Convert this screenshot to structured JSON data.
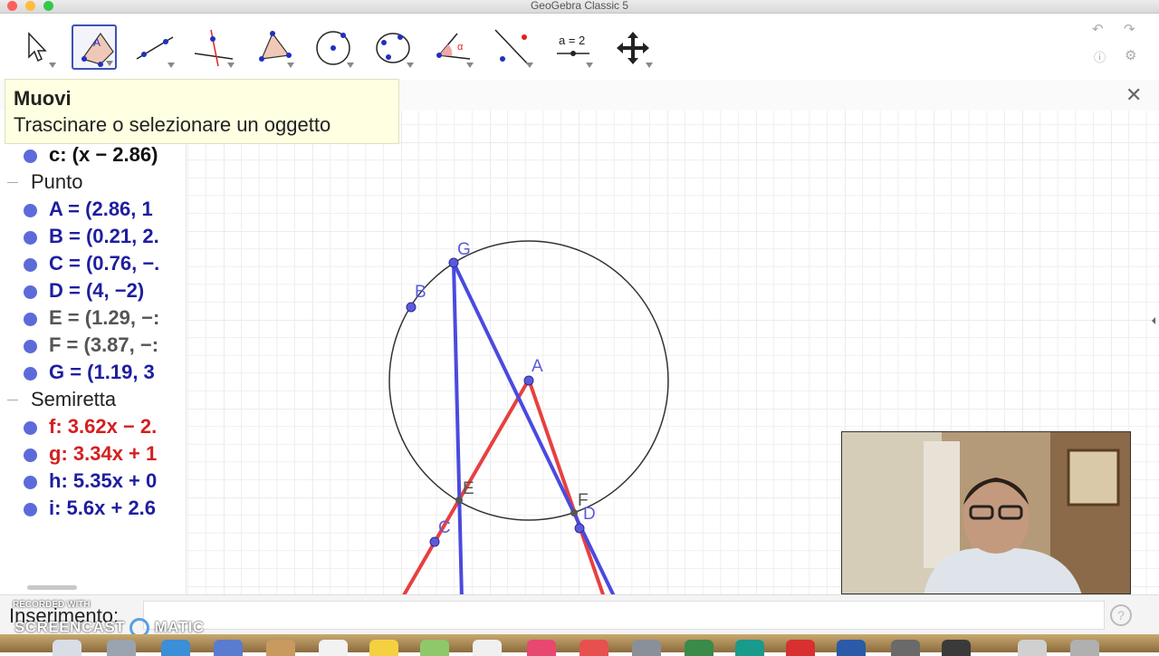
{
  "window": {
    "title": "GeoGebra Classic 5"
  },
  "toolbar": {
    "tools": [
      {
        "name": "move-tool",
        "selected": false
      },
      {
        "name": "polygon-tool",
        "selected": true,
        "letter": "A"
      },
      {
        "name": "line-tool",
        "selected": false
      },
      {
        "name": "perpendicular-line-tool",
        "selected": false
      },
      {
        "name": "polygon-triangle-tool",
        "selected": false
      },
      {
        "name": "circle-center-tool",
        "selected": false
      },
      {
        "name": "ellipse-tool",
        "selected": false
      },
      {
        "name": "angle-tool",
        "selected": false,
        "letter": "α"
      },
      {
        "name": "reflect-tool",
        "selected": false
      },
      {
        "name": "slider-tool",
        "selected": false,
        "letter": "a = 2"
      },
      {
        "name": "move-graphics-tool",
        "selected": false
      }
    ],
    "undo_icon": "undo-icon",
    "redo_icon": "redo-icon",
    "help_icon": "help-icon",
    "settings_icon": "gear-icon"
  },
  "tooltip": {
    "title": "Muovi",
    "description": "Trascinare o selezionare un oggetto"
  },
  "algebra": {
    "top_item": "c: (x − 2.86)",
    "groups": [
      {
        "header": "Punto",
        "items": [
          {
            "text": "A = (2.86, 1",
            "color": "#1e1ea0"
          },
          {
            "text": "B = (0.21, 2.",
            "color": "#1e1ea0"
          },
          {
            "text": "C = (0.76, −.",
            "color": "#1e1ea0"
          },
          {
            "text": "D = (4, −2)",
            "color": "#1e1ea0"
          },
          {
            "text": "E = (1.29, −:",
            "color": "#555555"
          },
          {
            "text": "F = (3.87, −:",
            "color": "#555555"
          },
          {
            "text": "G = (1.19, 3",
            "color": "#1e1ea0"
          }
        ]
      },
      {
        "header": "Semiretta",
        "items": [
          {
            "text": "f: 3.62x − 2.",
            "color": "#d42020"
          },
          {
            "text": "g: 3.34x + 1",
            "color": "#d42020"
          },
          {
            "text": "h: 5.35x + 0",
            "color": "#1e1ea0"
          },
          {
            "text": "i: 5.6x + 2.6",
            "color": "#1e1ea0"
          }
        ]
      }
    ]
  },
  "graphics": {
    "points": [
      {
        "label": "G",
        "color": "#5b5bd9"
      },
      {
        "label": "B",
        "color": "#5b5bd9"
      },
      {
        "label": "A",
        "color": "#5b5bd9"
      },
      {
        "label": "E",
        "color": "#555555"
      },
      {
        "label": "F",
        "color": "#555555"
      },
      {
        "label": "C",
        "color": "#5b5bd9"
      },
      {
        "label": "D",
        "color": "#5b5bd9"
      }
    ],
    "red_color": "#e84040",
    "blue_color": "#4a4ae0"
  },
  "input_bar": {
    "label": "Inserimento:",
    "help_icon": "help-icon"
  },
  "watermark": {
    "line1": "RECORDED WITH",
    "line2": "SCREENCAST",
    "line3": "MATIC"
  }
}
